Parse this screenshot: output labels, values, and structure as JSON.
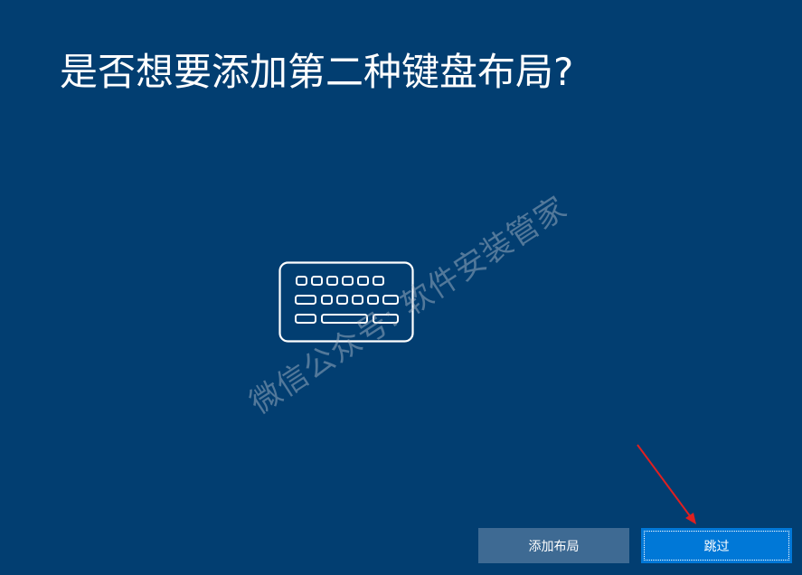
{
  "page": {
    "title": "是否想要添加第二种键盘布局?"
  },
  "illustration": {
    "icon": "keyboard-icon"
  },
  "watermark": {
    "text": "微信公众号: 软件安装管家"
  },
  "buttons": {
    "add_layout_label": "添加布局",
    "skip_label": "跳过"
  },
  "annotation": {
    "arrow_color": "#e02020"
  },
  "colors": {
    "background": "#023e71",
    "primary_button": "#0078d7",
    "secondary_button": "#3e6a93"
  }
}
